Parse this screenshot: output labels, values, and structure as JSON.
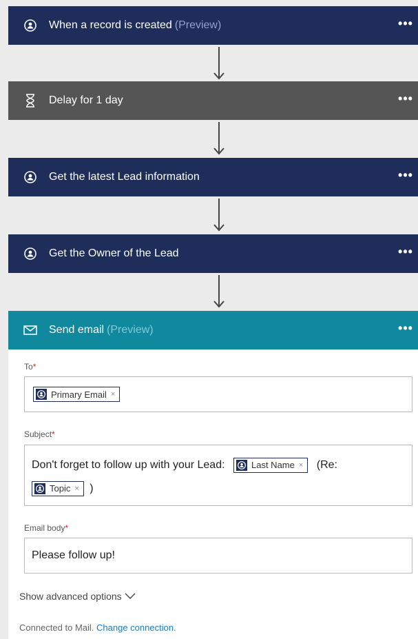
{
  "steps": [
    {
      "title": "When a record is created",
      "preview": "(Preview)",
      "menu": "•••"
    },
    {
      "title": "Delay for 1 day",
      "menu": "•••"
    },
    {
      "title": "Get the latest Lead information",
      "menu": "•••"
    },
    {
      "title": "Get the Owner of the Lead",
      "menu": "•••"
    },
    {
      "title": "Send email",
      "preview": "(Preview)",
      "menu": "•••"
    }
  ],
  "form": {
    "to_label": "To",
    "to_token": "Primary Email",
    "subject_label": "Subject",
    "subject_text": "Don't forget to follow up with your Lead:",
    "subject_token1": "Last Name",
    "subject_mid": "(Re:",
    "subject_token2": "Topic",
    "subject_end": ")",
    "body_label": "Email body",
    "body_text": "Please follow up!",
    "required_mark": "*",
    "token_remove": "×",
    "advanced": "Show advanced options",
    "connected_text": "Connected to Mail.",
    "change_connection": "Change connection."
  },
  "colors": {
    "crm_card": "#1f2d5a",
    "delay_card": "#555555",
    "mail_card": "#10889e",
    "required": "#e81123",
    "link": "#1a7cc1"
  },
  "icons": {
    "crm": "crm-person-icon",
    "delay": "hourglass-icon",
    "mail": "envelope-icon",
    "menu": "ellipsis-icon"
  }
}
